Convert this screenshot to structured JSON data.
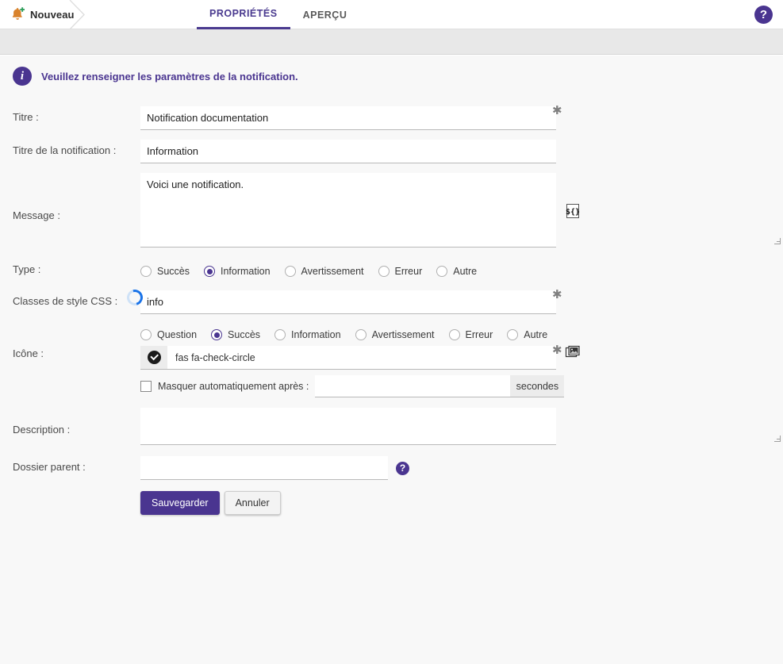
{
  "header": {
    "breadcrumb": {
      "label": "Nouveau",
      "icon": "bell-plus-icon"
    },
    "tabs": [
      {
        "label": "PROPRIÉTÉS",
        "active": true
      },
      {
        "label": "APERÇU",
        "active": false
      }
    ],
    "help_label": "?"
  },
  "banner": {
    "icon": "info-icon",
    "icon_glyph": "i",
    "text": "Veuillez renseigner les paramètres de la notification."
  },
  "form": {
    "title": {
      "label": "Titre :",
      "value": "Notification documentation",
      "placeholder": "",
      "required_marker": "✱"
    },
    "notification_title": {
      "label": "Titre de la notification :",
      "value": "Information",
      "placeholder": ""
    },
    "message": {
      "label": "Message :",
      "value": "Voici une notification.",
      "placeholder": "",
      "expression_button": "${}"
    },
    "type": {
      "label": "Type :",
      "options": [
        {
          "label": "Succès",
          "selected": false
        },
        {
          "label": "Information",
          "selected": true
        },
        {
          "label": "Avertissement",
          "selected": false
        },
        {
          "label": "Erreur",
          "selected": false
        },
        {
          "label": "Autre",
          "selected": false
        }
      ]
    },
    "css_classes": {
      "label": "Classes de style CSS :",
      "value": "info",
      "placeholder": "",
      "required_marker": "✱"
    },
    "icon": {
      "label": "Icône :",
      "options": [
        {
          "label": "Question",
          "selected": false
        },
        {
          "label": "Succès",
          "selected": true
        },
        {
          "label": "Information",
          "selected": false
        },
        {
          "label": "Avertissement",
          "selected": false
        },
        {
          "label": "Erreur",
          "selected": false
        },
        {
          "label": "Autre",
          "selected": false
        }
      ],
      "value": "fas fa-check-circle",
      "preview_icon": "check-circle-icon",
      "required_marker": "✱",
      "picker_button": "image-picker-icon"
    },
    "auto_hide": {
      "label": "Masquer automatiquement après :",
      "checked": false,
      "value": "",
      "placeholder": "",
      "unit": "secondes"
    },
    "description": {
      "label": "Description :",
      "value": "",
      "placeholder": ""
    },
    "parent_folder": {
      "label": "Dossier parent :",
      "value": "",
      "placeholder": "",
      "help_label": "?"
    },
    "actions": {
      "save_label": "Sauvegarder",
      "cancel_label": "Annuler"
    }
  },
  "status": {
    "spinner": "loading-spinner"
  },
  "colors": {
    "accent_purple": "#4a3590",
    "tab_active": "#4a3a8f",
    "spinner_blue": "#1a73e8",
    "bell_orange": "#d9822b",
    "plus_green": "#2e9e5b",
    "page_bg": "#f8f8f8",
    "toolbar_bg": "#e8e8e8"
  }
}
